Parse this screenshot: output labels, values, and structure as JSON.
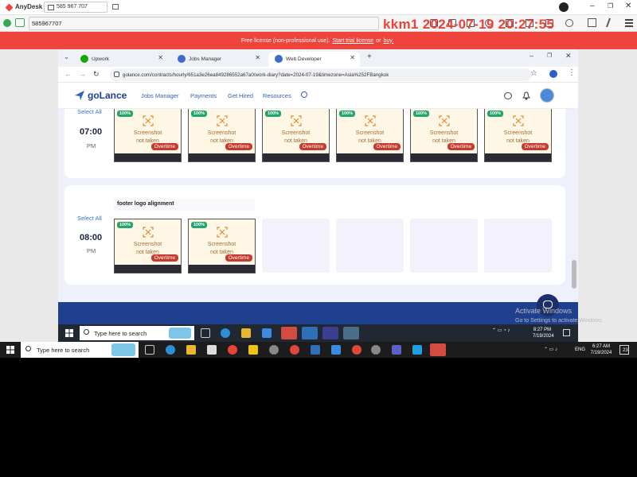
{
  "anydesk": {
    "app_name": "AnyDesk",
    "session_id": "585 967 707",
    "address_value": "585967707",
    "banner_text": "Free license (non-professional use).",
    "banner_link1": "Start trial license",
    "banner_or": "or",
    "banner_link2": "buy.",
    "watermark": "kkm1 2024-07-19 20:27:55"
  },
  "browser": {
    "tabs": [
      {
        "label": "Upwork",
        "color": "#14a800"
      },
      {
        "label": "Jobs Manager",
        "color": "#3d6bcc"
      },
      {
        "label": "Web Developer",
        "color": "#3d6bcc"
      }
    ],
    "url": "golance.com/contracts/hourly/651a3e26ea849286552a67a0/work-diary?date=2024-07-19&timezone=Asia%252FBangkok"
  },
  "golance": {
    "logo": "goLance",
    "nav": [
      "Jobs Manager",
      "Payments",
      "Get Hired",
      "Resources"
    ],
    "accent": "#2e63b8"
  },
  "diary": {
    "blocks": [
      {
        "select_all": "Select All",
        "hour": "07:00",
        "ampm": "PM",
        "memo": "",
        "slots": [
          {
            "percent": "100%",
            "line1": "Screenshot",
            "line2": "not taken",
            "badge": "Overtime"
          },
          {
            "percent": "100%",
            "line1": "Screenshot",
            "line2": "not taken",
            "badge": "Overtime"
          },
          {
            "percent": "100%",
            "line1": "Screenshot",
            "line2": "not taken",
            "badge": "Overtime"
          },
          {
            "percent": "100%",
            "line1": "Screenshot",
            "line2": "not taken",
            "badge": "Overtime"
          },
          {
            "percent": "100%",
            "line1": "Screenshot",
            "line2": "not taken",
            "badge": "Overtime"
          },
          {
            "percent": "100%",
            "line1": "Screenshot",
            "line2": "not taken",
            "badge": "Overtime"
          }
        ]
      },
      {
        "select_all": "Select All",
        "hour": "08:00",
        "ampm": "PM",
        "memo": "footer logo alignment",
        "slots": [
          {
            "percent": "100%",
            "line1": "Screenshot",
            "line2": "not taken",
            "badge": "Overtime"
          },
          {
            "percent": "100%",
            "line1": "Screenshot",
            "line2": "not taken",
            "badge": "Overtime"
          }
        ]
      }
    ]
  },
  "windows_notice": {
    "line1": "Activate Windows",
    "line2": "Go to Settings to activate Windows."
  },
  "taskbar_inner": {
    "search_placeholder": "Type here to search",
    "time": "8:27 PM",
    "date": "7/19/2024"
  },
  "taskbar_outer": {
    "search_placeholder": "Type here to search",
    "time": "6:27 AM",
    "date": "7/19/2024",
    "lang": "ENG",
    "notif_count": "23"
  }
}
